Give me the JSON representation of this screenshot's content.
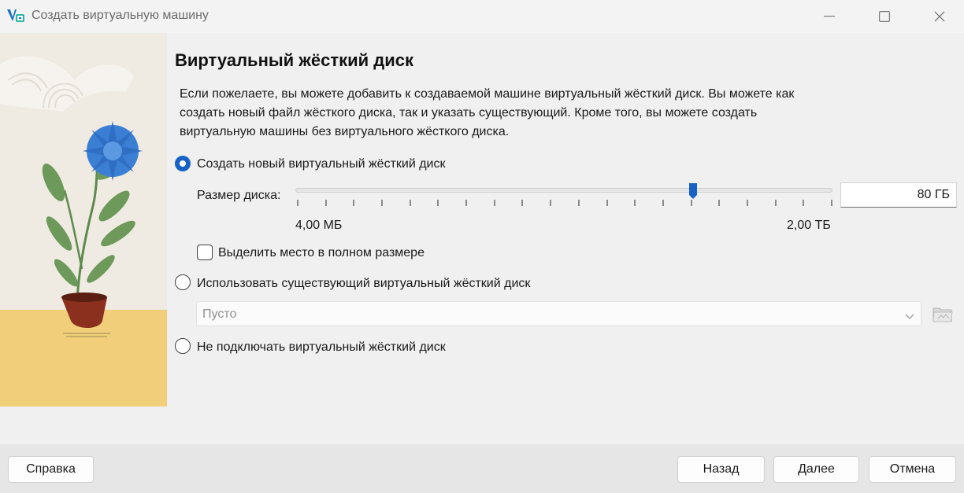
{
  "window": {
    "title": "Создать виртуальную машину"
  },
  "page": {
    "title": "Виртуальный жёсткий диск",
    "description_lines": [
      "Если пожелаете, вы можете добавить к создаваемой машине виртуальный жёсткий диск. Вы можете как",
      "создать новый файл жёсткого диска, так и указать существующий. Кроме того, вы можете создать",
      "виртуальную машины без виртуального жёсткого диска."
    ]
  },
  "options": {
    "create_new": {
      "label": "Создать новый виртуальный жёсткий диск",
      "checked": true
    },
    "use_existing": {
      "label": "Использовать существующий виртуальный жёсткий диск",
      "checked": false
    },
    "no_disk": {
      "label": "Не подключать виртуальный жёсткий диск",
      "checked": false
    }
  },
  "disk_size": {
    "label": "Размер диска:",
    "value": "80 ГБ",
    "min_label": "4,00 МБ",
    "max_label": "2,00 ТБ",
    "slider_position_fraction": 0.74
  },
  "preallocate": {
    "label": "Выделить место в полном размере",
    "checked": false
  },
  "existing_disk_combo": {
    "value": "Пусто"
  },
  "footer": {
    "help_label": "Справка",
    "back_label": "Назад",
    "next_label": "Далее",
    "cancel_label": "Отмена"
  },
  "colors": {
    "accent": "#1762c4"
  }
}
